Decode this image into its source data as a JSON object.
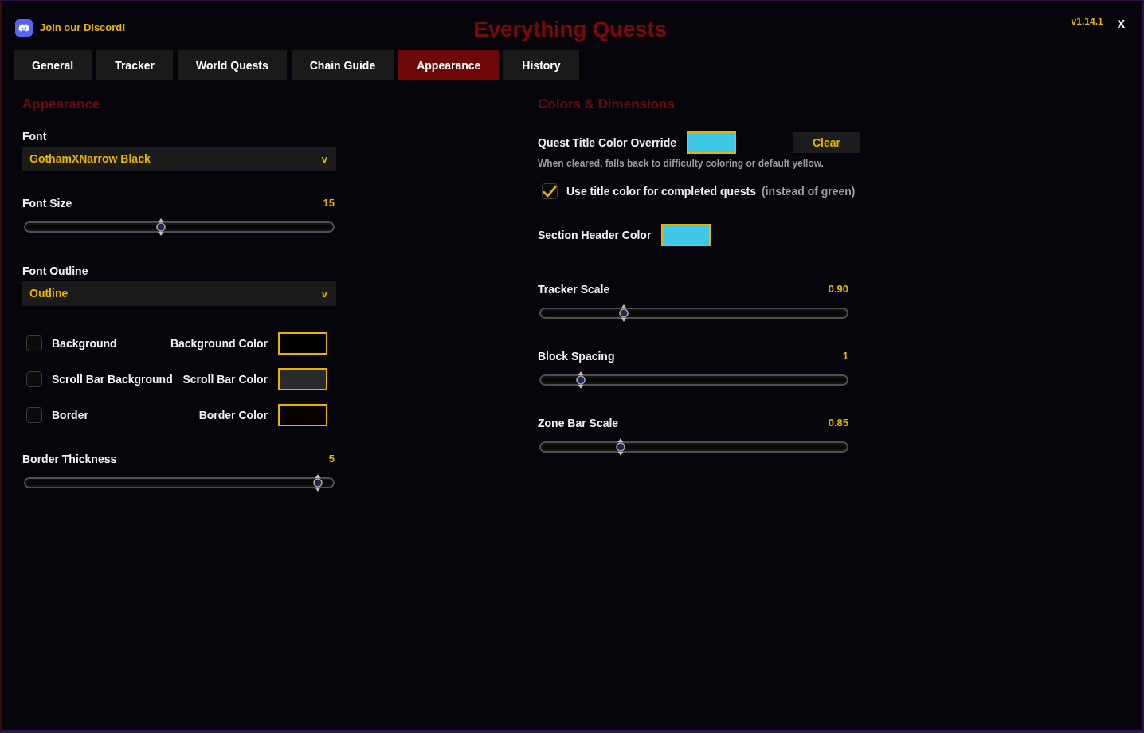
{
  "header": {
    "link": "Join our Discord!",
    "title": "Everything Quests",
    "version": "v1.14.1",
    "close": "X"
  },
  "tabs": [
    {
      "label": "General",
      "selected": false
    },
    {
      "label": "Tracker",
      "selected": false
    },
    {
      "label": "World Quests",
      "selected": false
    },
    {
      "label": "Chain Guide",
      "selected": false
    },
    {
      "label": "Appearance",
      "selected": true
    },
    {
      "label": "History",
      "selected": false
    }
  ],
  "left_panel": {
    "heading": "Appearance",
    "controls": [
      {
        "kind": "dropdown",
        "label": "Font",
        "value": "GothamXNarrow Black",
        "caret": "v"
      },
      {
        "kind": "slider",
        "label": "Font Size",
        "reading": "15",
        "level": 0.44
      },
      {
        "kind": "dropdown",
        "label": "Font Outline",
        "value": "Outline",
        "caret": "v"
      },
      {
        "kind": "toggles",
        "rows": [
          {
            "label": "Background",
            "checked": false,
            "color_label": "Background Color",
            "color": "#000000"
          },
          {
            "label": "Scroll Bar Background",
            "checked": false,
            "color_label": "Scroll Bar Color",
            "color": "#2a2a2e"
          },
          {
            "label": "Border",
            "checked": false,
            "color_label": "Border Color",
            "color": "#0a0000"
          }
        ]
      },
      {
        "kind": "slider",
        "label": "Border Thickness",
        "reading": "5",
        "level": 0.95
      }
    ]
  },
  "right_panel": {
    "heading": "Colors & Dimensions",
    "controls": [
      {
        "kind": "color",
        "label": "Quest Title Color Override",
        "color": "#40c8e8",
        "button": "Clear"
      },
      {
        "kind": "hint",
        "text": "When cleared, falls back to difficulty coloring or default yellow."
      },
      {
        "kind": "checkbox",
        "label": "Use title color for completed quests",
        "note": "(instead of green)",
        "checked": true
      },
      {
        "kind": "color",
        "label": "Section Header Color",
        "color": "#40c8e8"
      },
      {
        "kind": "slider",
        "label": "Tracker Scale",
        "reading": "0.90",
        "level": 0.27
      },
      {
        "kind": "slider",
        "label": "Block Spacing",
        "reading": "1",
        "level": 0.13
      },
      {
        "kind": "slider",
        "label": "Zone Bar Scale",
        "reading": "0.85",
        "level": 0.26
      }
    ]
  }
}
